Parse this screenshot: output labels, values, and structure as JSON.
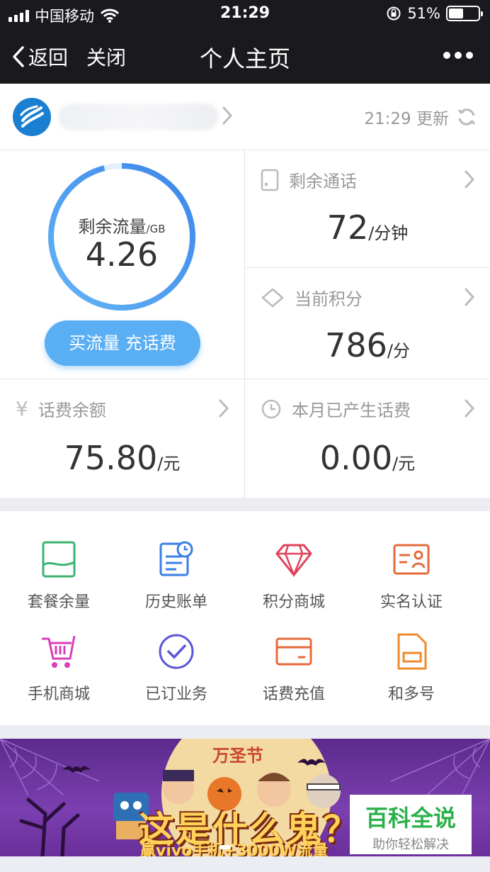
{
  "status_bar": {
    "carrier": "中国移动",
    "time": "21:29",
    "battery": "51%",
    "battery_level": 0.51
  },
  "nav": {
    "back_label": "返回",
    "close_label": "关闭",
    "title": "个人主页"
  },
  "account": {
    "update_time": "21:29 更新"
  },
  "data_flow": {
    "label": "剩余流量",
    "unit": "/GB",
    "value": "4.26",
    "ring_fraction": 0.96,
    "button_label": "买流量 充话费"
  },
  "cards": {
    "call": {
      "label": "剩余通话",
      "value": "72",
      "unit": "/分钟"
    },
    "points": {
      "label": "当前积分",
      "value": "786",
      "unit": "/分"
    },
    "balance": {
      "icon": "¥",
      "label": "话费余额",
      "value": "75.80",
      "unit": "/元"
    },
    "monthly": {
      "label": "本月已产生话费",
      "value": "0.00",
      "unit": "/元"
    }
  },
  "services": [
    {
      "label": "套餐余量",
      "icon": "package-icon",
      "color": "#3cb371"
    },
    {
      "label": "历史账单",
      "icon": "bill-history-icon",
      "color": "#3a7ee6"
    },
    {
      "label": "积分商城",
      "icon": "diamond-icon",
      "color": "#e0415a"
    },
    {
      "label": "实名认证",
      "icon": "id-card-icon",
      "color": "#e46a3a"
    },
    {
      "label": "手机商城",
      "icon": "cart-icon",
      "color": "#d93fb8"
    },
    {
      "label": "已订业务",
      "icon": "check-circle-icon",
      "color": "#5b56d6"
    },
    {
      "label": "话费充值",
      "icon": "card-icon",
      "color": "#e46a3a"
    },
    {
      "label": "和多号",
      "icon": "sim-icon",
      "color": "#ef8a2a"
    }
  ],
  "banner": {
    "festival": "万圣节",
    "headline": "这是什么鬼？",
    "sub": "赢vivo手机+3000W流量"
  },
  "watermark": {
    "title": "百科全说",
    "subtitle": "助你轻松解决"
  }
}
